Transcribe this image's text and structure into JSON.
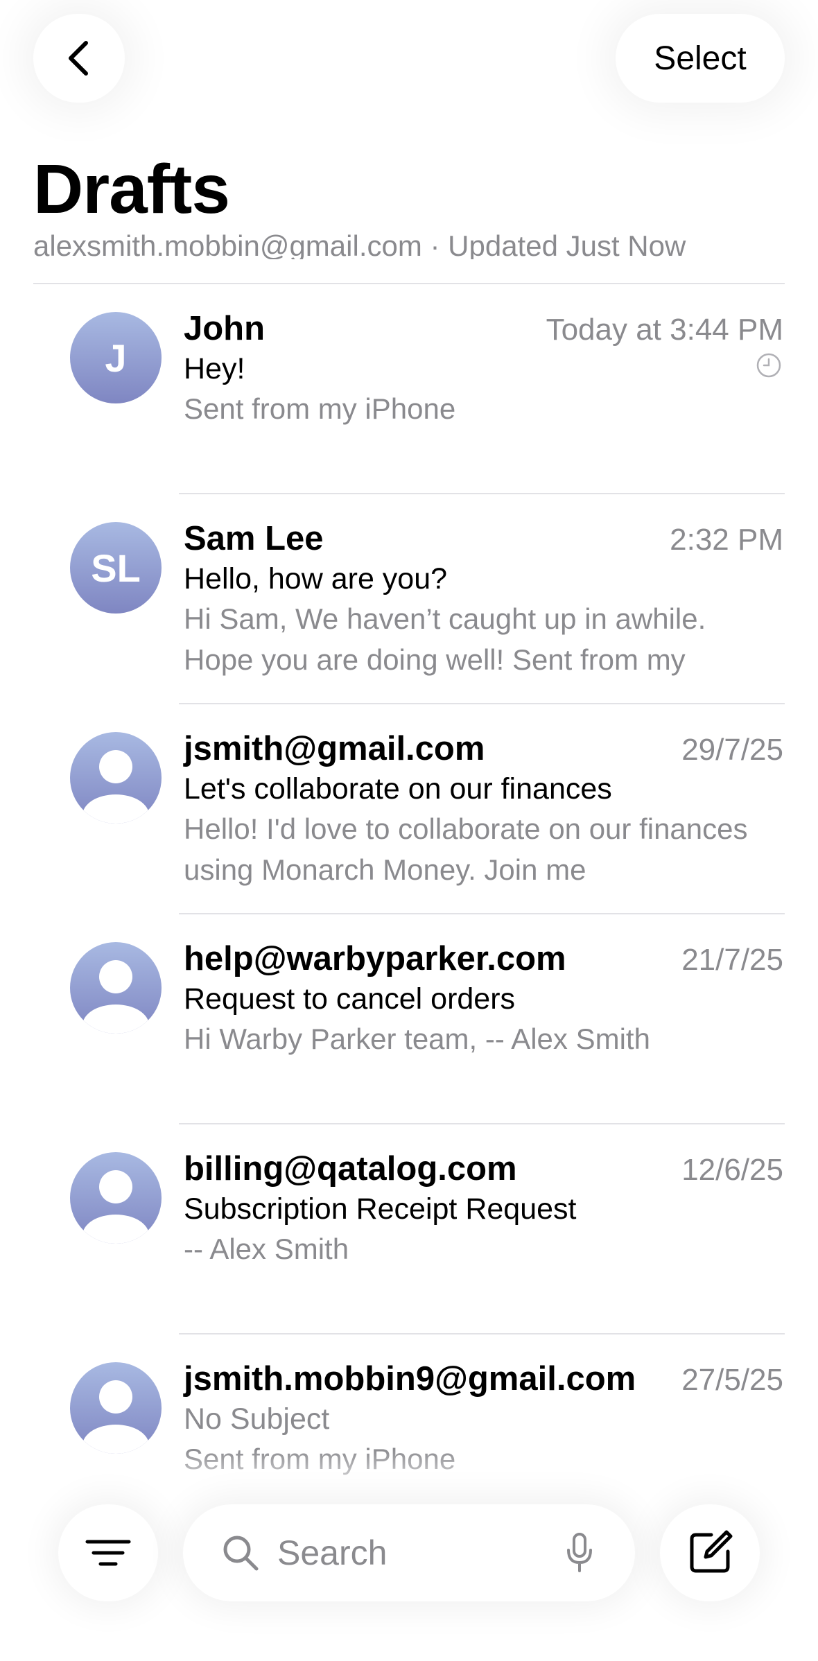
{
  "header": {
    "select_label": "Select",
    "title": "Drafts",
    "subtitle": "alexsmith.mobbin@gmail.com · Updated Just Now"
  },
  "drafts": [
    {
      "sender": "John",
      "date": "Today at 3:44 PM",
      "subject": "Hey!",
      "preview": "Sent from my iPhone",
      "avatar": "J"
    },
    {
      "sender": "Sam Lee",
      "date": "2:32 PM",
      "subject": "Hello, how are you?",
      "preview": "Hi Sam, We haven’t caught up in awhile. Hope you are doing well! Sent from my",
      "avatar": "SL"
    },
    {
      "sender": "jsmith@gmail.com",
      "date": "29/7/25",
      "subject": "Let's collaborate on our finances",
      "preview": "Hello! I'd love to collaborate on our finances using Monarch Money. Join me",
      "avatar": "person-icon"
    },
    {
      "sender": "help@warbyparker.com",
      "date": "21/7/25",
      "subject": "Request to cancel orders",
      "preview": "Hi Warby Parker team, -- Alex Smith",
      "avatar": "person-icon"
    },
    {
      "sender": "billing@qatalog.com",
      "date": "12/6/25",
      "subject": "Subscription Receipt Request",
      "preview": "-- Alex Smith",
      "avatar": "person-icon"
    },
    {
      "sender": "jsmith.mobbin9@gmail.com",
      "date": "27/5/25",
      "subject": "No Subject",
      "preview": "Sent from my iPhone",
      "avatar": "person-icon"
    }
  ],
  "toolbar": {
    "search_placeholder": "Search",
    "icons": [
      "filter-icon",
      "search-icon",
      "microphone-icon",
      "compose-icon"
    ]
  },
  "colors": {
    "secondary_text": "#8a8a8e",
    "avatar_gradient_top": "#a8b9e2",
    "avatar_gradient_bottom": "#7f86c2",
    "divider": "#e2e2e6"
  }
}
